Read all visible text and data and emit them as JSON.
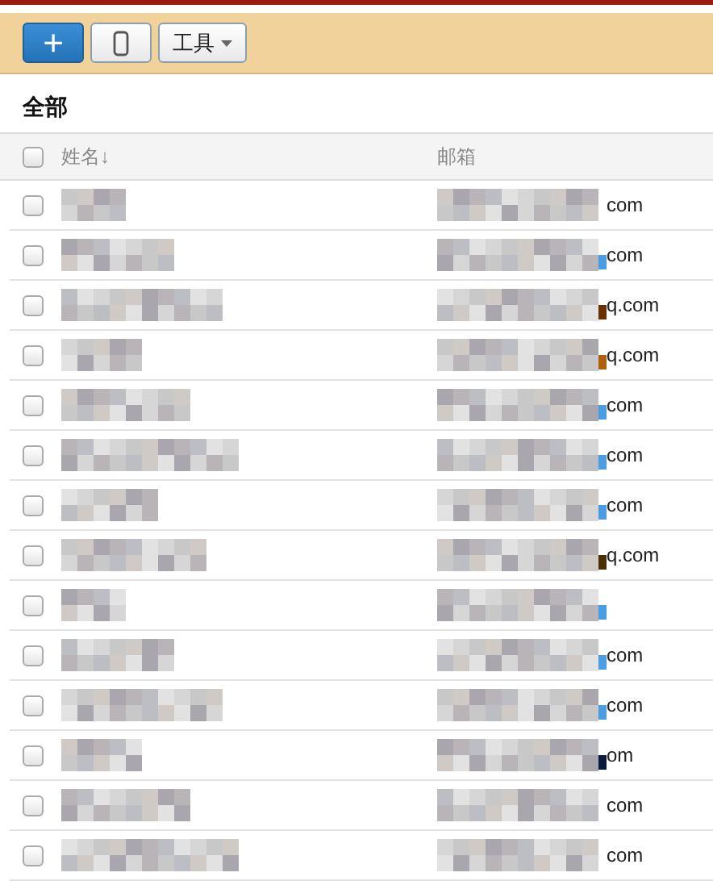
{
  "toolbar": {
    "add_button": "+",
    "tools_button": "工具"
  },
  "heading": "全部",
  "table": {
    "columns": [
      "姓名↓",
      "邮箱"
    ],
    "all_checked": false,
    "rows": [
      {
        "checked": false,
        "email_end": "com"
      },
      {
        "checked": false,
        "email_end": "com",
        "color": "#4a9de0"
      },
      {
        "checked": false,
        "email_end": "q.com",
        "color": "#6b3000"
      },
      {
        "checked": false,
        "email_end": "q.com",
        "color": "#b0600a"
      },
      {
        "checked": false,
        "email_end": "com",
        "color": "#4a9de0"
      },
      {
        "checked": false,
        "email_end": "com",
        "color": "#4a9de0"
      },
      {
        "checked": false,
        "email_end": "com",
        "color": "#4a9de0"
      },
      {
        "checked": false,
        "email_end": "q.com",
        "color": "#4a3000"
      },
      {
        "checked": false,
        "color": "#4a9de0"
      },
      {
        "checked": false,
        "email_end": "com",
        "color": "#4a9de0"
      },
      {
        "checked": false,
        "email_end": "com",
        "color": "#4a9de0"
      },
      {
        "checked": false,
        "email_end": "om",
        "color": "#0a1a3a"
      },
      {
        "checked": false,
        "email_end": "com"
      },
      {
        "checked": false,
        "email_end": "com"
      }
    ]
  }
}
